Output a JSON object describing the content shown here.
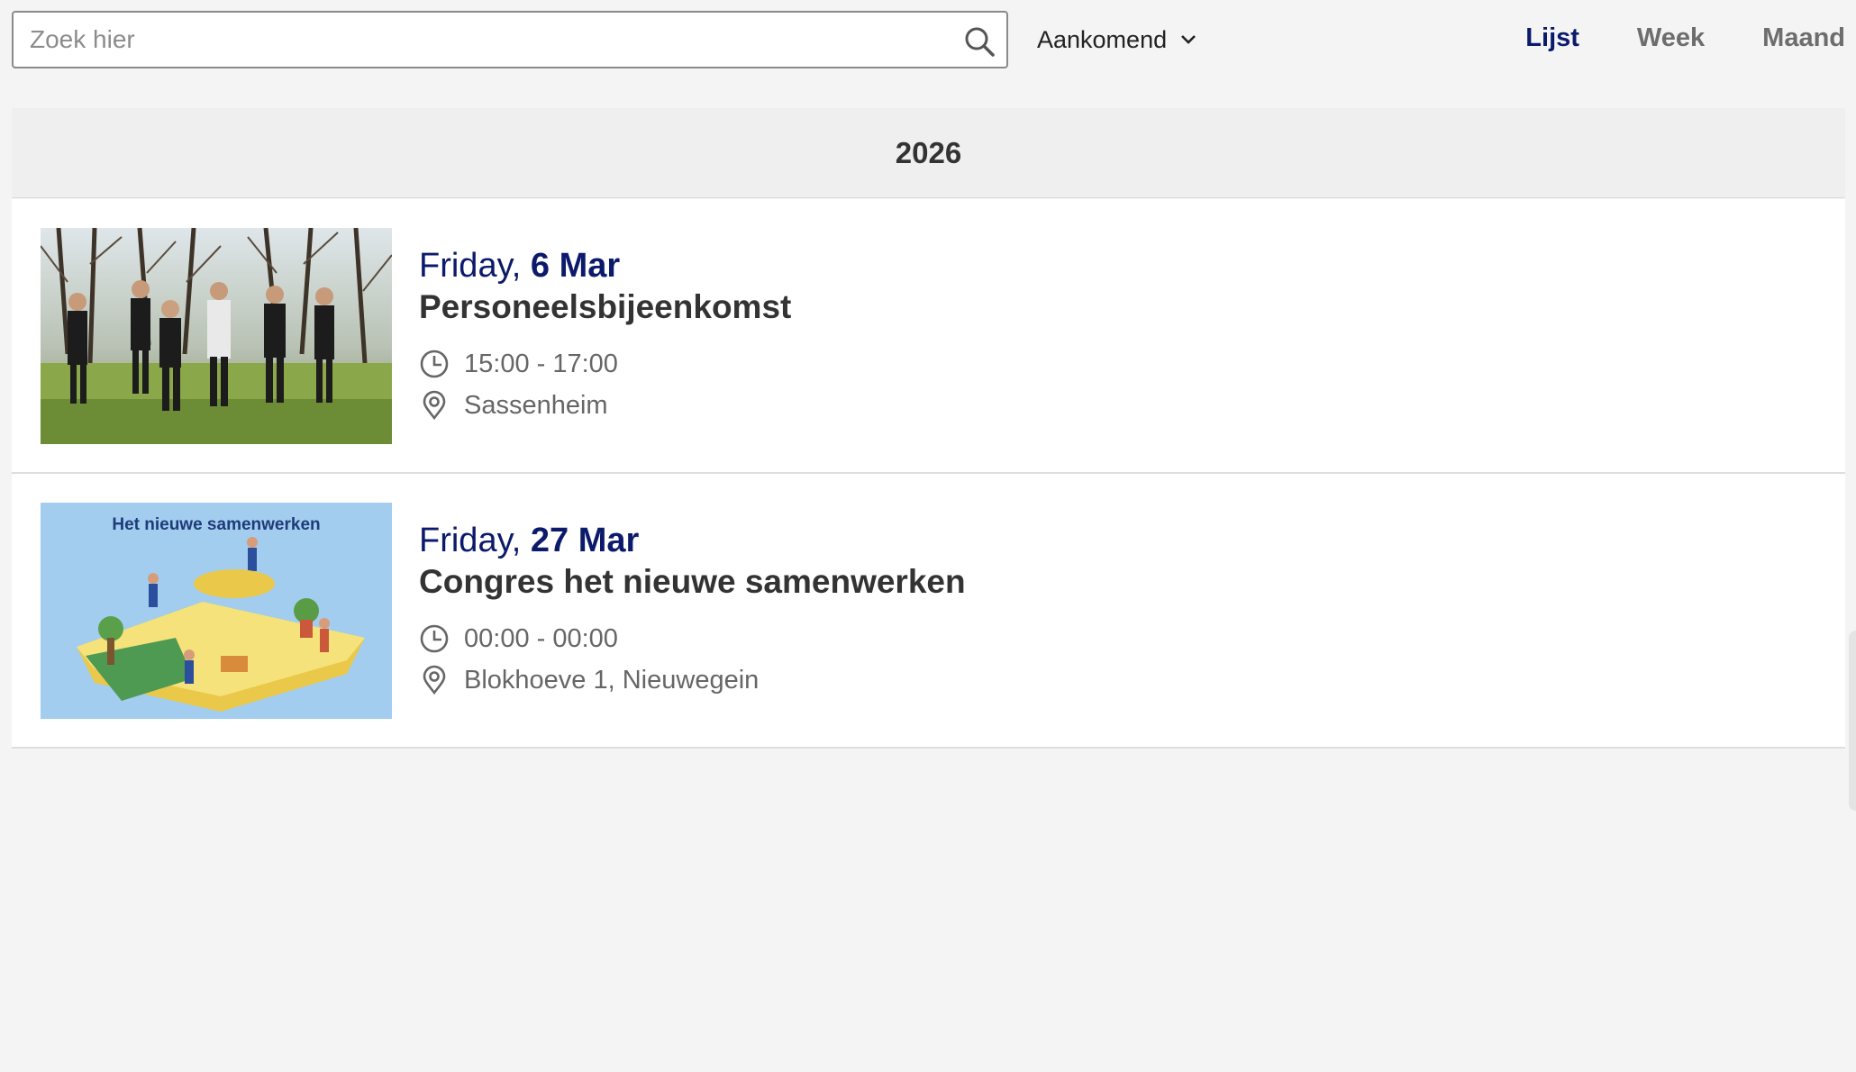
{
  "search": {
    "placeholder": "Zoek hier",
    "value": ""
  },
  "filter": {
    "label": "Aankomend"
  },
  "views": [
    {
      "label": "Lijst",
      "active": true
    },
    {
      "label": "Week",
      "active": false
    },
    {
      "label": "Maand",
      "active": false
    }
  ],
  "year": "2026",
  "events": [
    {
      "weekday": "Friday,",
      "date": "6 Mar",
      "title": "Personeelsbijeenkomst",
      "time": "15:00 - 17:00",
      "location": "Sassenheim",
      "image": "group-of-people-in-park"
    },
    {
      "weekday": "Friday,",
      "date": "27 Mar",
      "title": "Congres het nieuwe samenwerken",
      "time": "00:00 - 00:00",
      "location": "Blokhoeve 1, Nieuwegein",
      "image": "illustration-het-nieuwe-samenwerken",
      "image_text": "Het nieuwe samenwerken"
    }
  ],
  "colors": {
    "accent": "#0c1a6b",
    "background": "#f4f4f4",
    "card": "#ffffff"
  }
}
